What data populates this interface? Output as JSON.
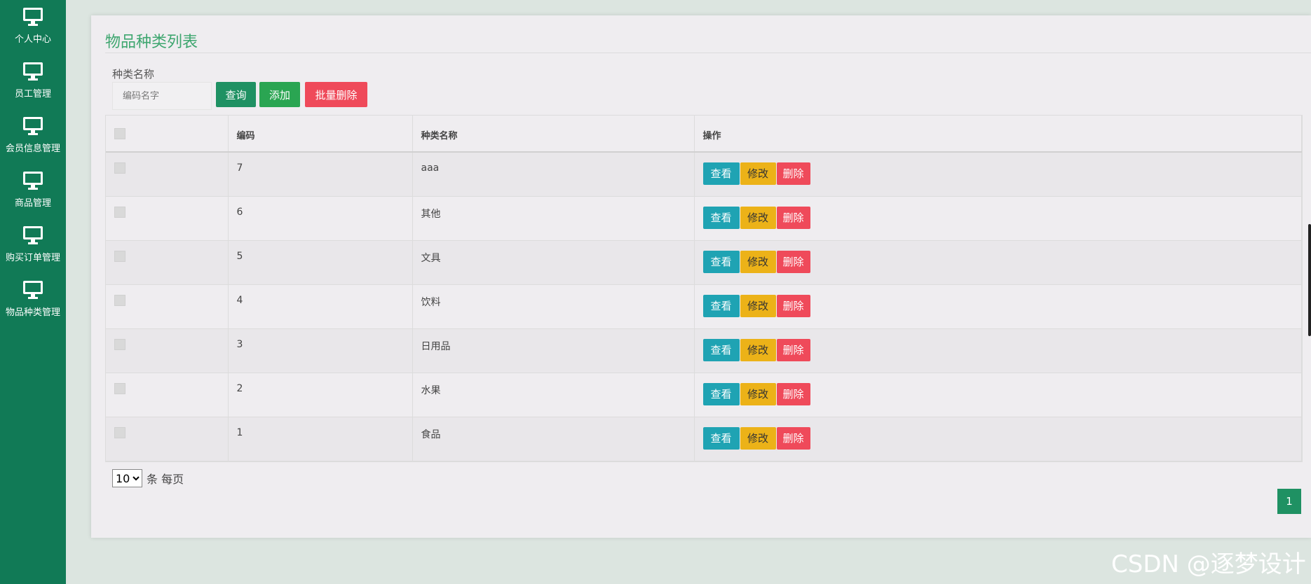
{
  "sidebar": {
    "items": [
      {
        "label": "个人中心",
        "icon": "monitor-icon"
      },
      {
        "label": "员工管理",
        "icon": "monitor-icon"
      },
      {
        "label": "会员信息管理",
        "icon": "monitor-icon"
      },
      {
        "label": "商品管理",
        "icon": "monitor-icon"
      },
      {
        "label": "购买订单管理",
        "icon": "monitor-icon"
      },
      {
        "label": "物品种类管理",
        "icon": "monitor-icon"
      }
    ]
  },
  "page": {
    "title": "物品种类列表",
    "search_label": "种类名称",
    "search_placeholder": "编码名字",
    "query_button": "查询",
    "add_button": "添加",
    "batch_delete_button": "批量删除"
  },
  "table": {
    "headers": [
      "编码",
      "种类名称",
      "操作"
    ],
    "rows": [
      {
        "code": "7",
        "name": "aaa"
      },
      {
        "code": "6",
        "name": "其他"
      },
      {
        "code": "5",
        "name": "文具"
      },
      {
        "code": "4",
        "name": "饮料"
      },
      {
        "code": "3",
        "name": "日用品"
      },
      {
        "code": "2",
        "name": "水果"
      },
      {
        "code": "1",
        "name": "食品"
      }
    ],
    "actions": {
      "view": "查看",
      "edit": "修改",
      "delete": "删除"
    }
  },
  "pagination": {
    "page_size": "10",
    "page_size_suffix": "条 每页",
    "current_page": "1"
  },
  "watermark": "CSDN @逐梦设计",
  "colors": {
    "sidebar": "#117a56",
    "title": "#3ea66f",
    "query": "#1f9163",
    "add": "#2aa552",
    "danger": "#ef4a5a",
    "view": "#1fa3b3",
    "edit": "#ecb218"
  }
}
